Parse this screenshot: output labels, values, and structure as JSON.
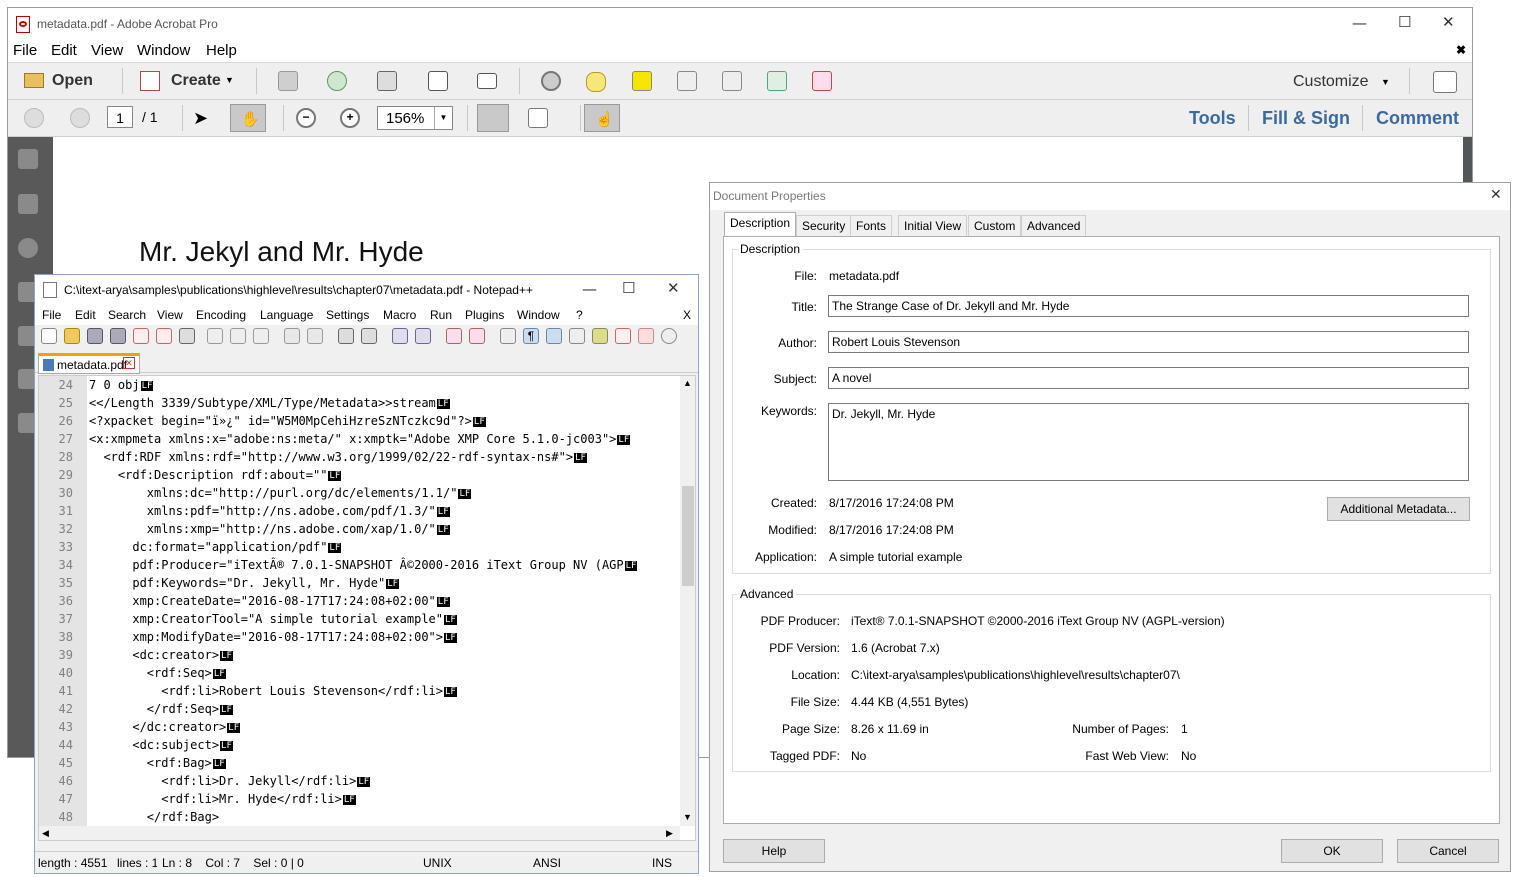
{
  "acrobat": {
    "title": "metadata.pdf - Adobe Acrobat Pro",
    "menu": [
      "File",
      "Edit",
      "View",
      "Window",
      "Help"
    ],
    "toolbar": {
      "open": "Open",
      "create": "Create",
      "customize": "Customize"
    },
    "nav": {
      "page": "1",
      "of": "/ 1",
      "zoom": "156%"
    },
    "panels": [
      "Tools",
      "Fill & Sign",
      "Comment"
    ],
    "doc_heading": "Mr. Jekyl and Mr. Hyde"
  },
  "notepad": {
    "title": "C:\\itext-arya\\samples\\publications\\highlevel\\results\\chapter07\\metadata.pdf - Notepad++",
    "menu": [
      "File",
      "Edit",
      "Search",
      "View",
      "Encoding",
      "Language",
      "Settings",
      "Macro",
      "Run",
      "Plugins",
      "Window",
      "?"
    ],
    "close_x": "X",
    "tab": "metadata.pdf",
    "lines": [
      {
        "n": "24",
        "t": "7 0 obj"
      },
      {
        "n": "25",
        "t": "<</Length 3339/Subtype/XML/Type/Metadata>>stream"
      },
      {
        "n": "26",
        "t": "<?xpacket begin=\"ï»¿\" id=\"W5M0MpCehiHzreSzNTczkc9d\"?>"
      },
      {
        "n": "27",
        "t": "<x:xmpmeta xmlns:x=\"adobe:ns:meta/\" x:xmptk=\"Adobe XMP Core 5.1.0-jc003\">"
      },
      {
        "n": "28",
        "t": "  <rdf:RDF xmlns:rdf=\"http://www.w3.org/1999/02/22-rdf-syntax-ns#\">"
      },
      {
        "n": "29",
        "t": "    <rdf:Description rdf:about=\"\""
      },
      {
        "n": "30",
        "t": "        xmlns:dc=\"http://purl.org/dc/elements/1.1/\""
      },
      {
        "n": "31",
        "t": "        xmlns:pdf=\"http://ns.adobe.com/pdf/1.3/\""
      },
      {
        "n": "32",
        "t": "        xmlns:xmp=\"http://ns.adobe.com/xap/1.0/\""
      },
      {
        "n": "33",
        "t": "      dc:format=\"application/pdf\""
      },
      {
        "n": "34",
        "t": "      pdf:Producer=\"iTextÂ® 7.0.1-SNAPSHOT Â©2000-2016 iText Group NV (AGP"
      },
      {
        "n": "35",
        "t": "      pdf:Keywords=\"Dr. Jekyll, Mr. Hyde\""
      },
      {
        "n": "36",
        "t": "      xmp:CreateDate=\"2016-08-17T17:24:08+02:00\""
      },
      {
        "n": "37",
        "t": "      xmp:CreatorTool=\"A simple tutorial example\""
      },
      {
        "n": "38",
        "t": "      xmp:ModifyDate=\"2016-08-17T17:24:08+02:00\">"
      },
      {
        "n": "39",
        "t": "      <dc:creator>"
      },
      {
        "n": "40",
        "t": "        <rdf:Seq>"
      },
      {
        "n": "41",
        "t": "          <rdf:li>Robert Louis Stevenson</rdf:li>"
      },
      {
        "n": "42",
        "t": "        </rdf:Seq>"
      },
      {
        "n": "43",
        "t": "      </dc:creator>"
      },
      {
        "n": "44",
        "t": "      <dc:subject>"
      },
      {
        "n": "45",
        "t": "        <rdf:Bag>"
      },
      {
        "n": "46",
        "t": "          <rdf:li>Dr. Jekyll</rdf:li>"
      },
      {
        "n": "47",
        "t": "          <rdf:li>Mr. Hyde</rdf:li>"
      },
      {
        "n": "48",
        "t": "        </rdf:Bag>"
      }
    ],
    "lf": "LF",
    "status": {
      "length": "length : 4551",
      "lines": "lines : 1(",
      "pos": "Ln : 8    Col : 7    Sel : 0 | 0",
      "eol": "UNIX",
      "enc": "ANSI",
      "mode": "INS"
    }
  },
  "docprops": {
    "title": "Document Properties",
    "tabs": [
      "Description",
      "Security",
      "Fonts",
      "Initial View",
      "Custom",
      "Advanced"
    ],
    "description_group": "Description",
    "labels": {
      "file": "File:",
      "title": "Title:",
      "author": "Author:",
      "subject": "Subject:",
      "keywords": "Keywords:",
      "created": "Created:",
      "modified": "Modified:",
      "application": "Application:"
    },
    "values": {
      "file": "metadata.pdf",
      "title": "The Strange Case of Dr. Jekyll and Mr. Hyde",
      "author": "Robert Louis Stevenson",
      "subject": "A novel",
      "keywords": "Dr. Jekyll, Mr. Hyde",
      "created": "8/17/2016 17:24:08 PM",
      "modified": "8/17/2016 17:24:08 PM",
      "application": "A simple tutorial example"
    },
    "additional_metadata": "Additional Metadata...",
    "advanced_group": "Advanced",
    "adv_labels": {
      "producer": "PDF Producer:",
      "version": "PDF Version:",
      "location": "Location:",
      "filesize": "File Size:",
      "pagesize": "Page Size:",
      "pages": "Number of Pages:",
      "tagged": "Tagged PDF:",
      "fastweb": "Fast Web View:"
    },
    "adv_values": {
      "producer": "iText® 7.0.1-SNAPSHOT ©2000-2016 iText Group NV (AGPL-version)",
      "version": "1.6 (Acrobat 7.x)",
      "location": "C:\\itext-arya\\samples\\publications\\highlevel\\results\\chapter07\\",
      "filesize": "4.44 KB (4,551 Bytes)",
      "pagesize": "8.26 x 11.69 in",
      "pages": "1",
      "tagged": "No",
      "fastweb": "No"
    },
    "buttons": {
      "help": "Help",
      "ok": "OK",
      "cancel": "Cancel"
    }
  }
}
